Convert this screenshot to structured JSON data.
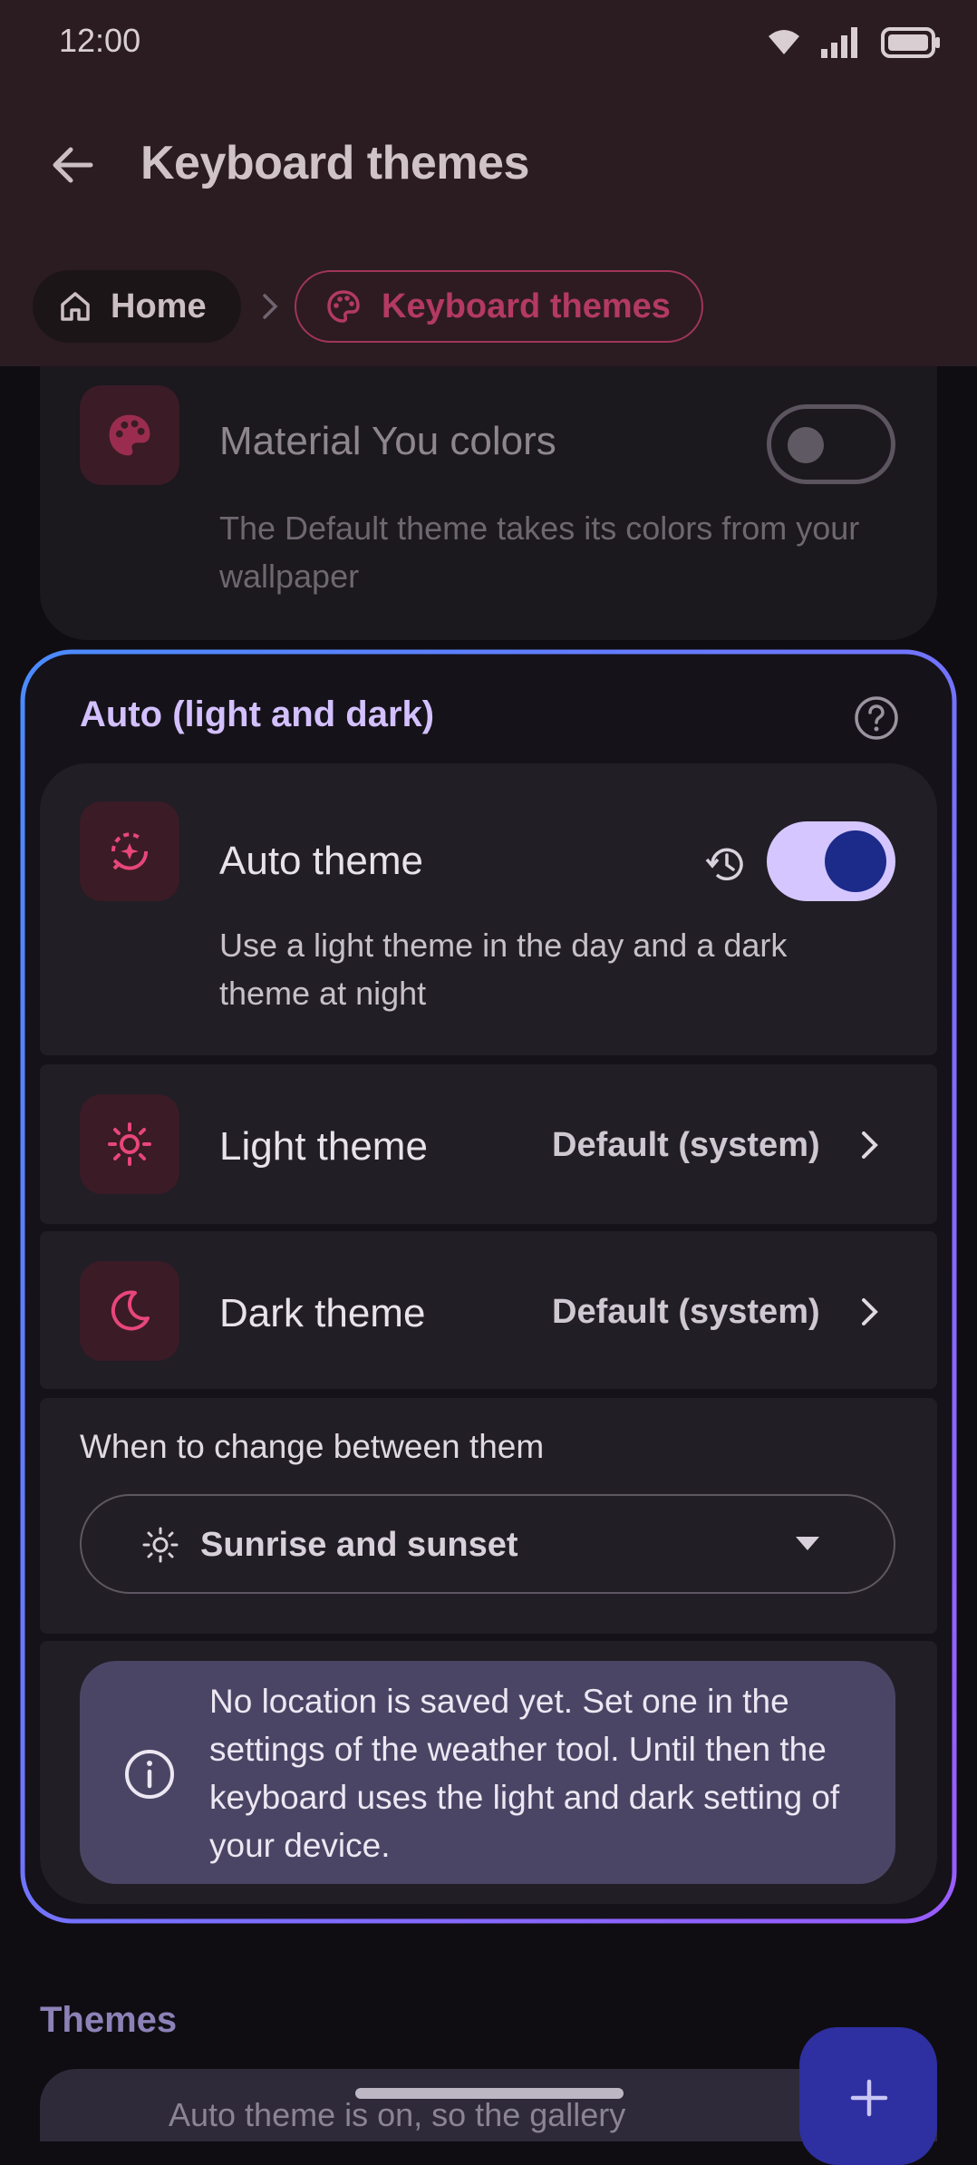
{
  "status_bar": {
    "time": "12:00"
  },
  "top_bar": {
    "title": "Keyboard themes",
    "back_icon": "arrow-left-icon"
  },
  "breadcrumb": {
    "home_label": "Home",
    "current_label": "Keyboard themes"
  },
  "material_you": {
    "title": "Material You colors",
    "subtitle": "The Default theme takes its colors from your wallpaper",
    "enabled": false
  },
  "auto_section": {
    "header": "Auto (light and dark)",
    "auto_theme": {
      "title": "Auto theme",
      "subtitle": "Use a light theme in the day and a dark theme at night",
      "enabled": true
    },
    "light_theme": {
      "title": "Light theme",
      "value": "Default (system)"
    },
    "dark_theme": {
      "title": "Dark theme",
      "value": "Default (system)"
    },
    "when_to_change": {
      "label": "When to change between them",
      "selected": "Sunrise and sunset"
    },
    "info": "No location is saved yet. Set one in the settings of the weather tool. Until then the keyboard uses the light and dark setting of your device."
  },
  "themes_section": {
    "header": "Themes",
    "card_text": "Auto theme is on, so the gallery"
  },
  "colors": {
    "accent_pink": "#e8467a",
    "toggle_on_track": "#d5c6ff",
    "toggle_on_knob": "#1c2a8a",
    "section_header": "#d3c0ff",
    "info_bg": "#4b4565"
  }
}
